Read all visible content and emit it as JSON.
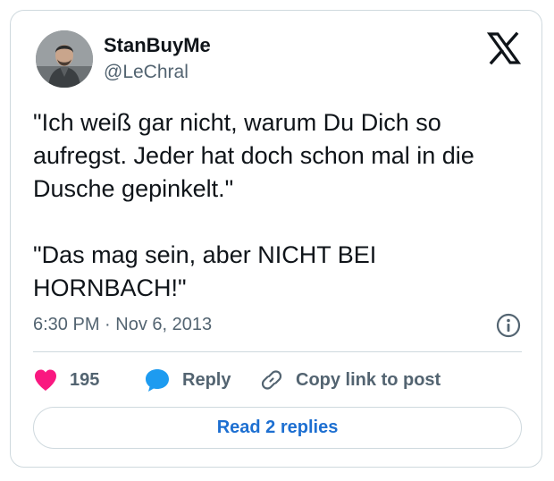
{
  "author": {
    "name": "StanBuyMe",
    "handle": "@LeChral"
  },
  "tweet": {
    "text": "\"Ich weiß gar nicht, warum Du Dich so aufregst. Jeder hat doch schon mal in die Dusche gepinkelt.\"\n\n\"Das mag sein, aber NICHT BEI HORNBACH!\"",
    "timestamp": "6:30 PM · Nov 6, 2013"
  },
  "actions": {
    "like_count": "195",
    "reply_label": "Reply",
    "copy_label": "Copy link to post"
  },
  "replies_button": {
    "label": "Read 2 replies"
  },
  "icons": {
    "logo": "x-logo-icon",
    "info": "info-icon",
    "like": "heart-icon",
    "reply": "speech-bubble-icon",
    "copy": "link-icon"
  },
  "colors": {
    "heart": "#f91880",
    "reply_bubble": "#1d9bf0",
    "link_blue": "#1d9bf0",
    "secondary_text": "#536471",
    "border": "#cfd9de"
  }
}
